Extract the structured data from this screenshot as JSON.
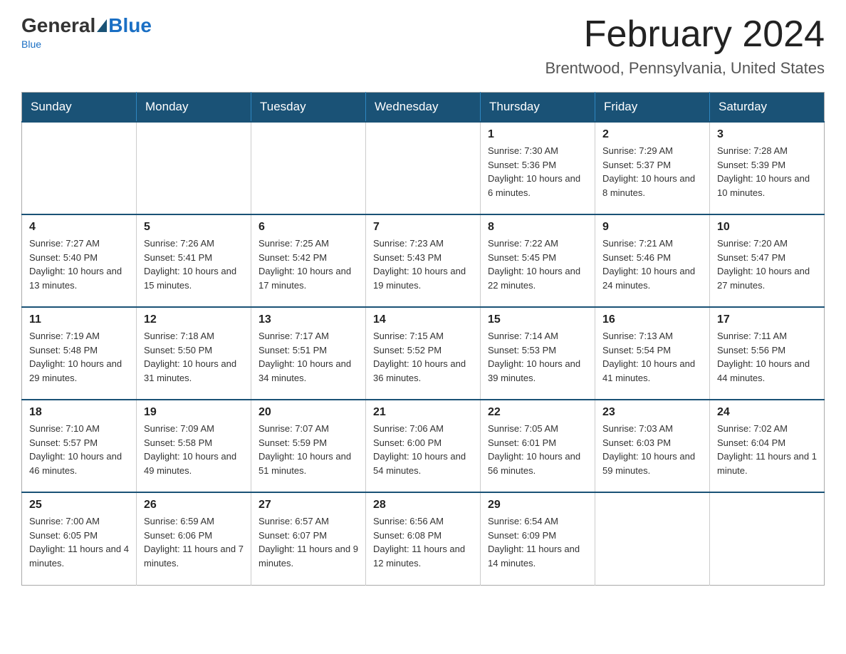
{
  "header": {
    "logo_general": "General",
    "logo_blue": "Blue",
    "title": "February 2024",
    "subtitle": "Brentwood, Pennsylvania, United States"
  },
  "calendar": {
    "days_of_week": [
      "Sunday",
      "Monday",
      "Tuesday",
      "Wednesday",
      "Thursday",
      "Friday",
      "Saturday"
    ],
    "weeks": [
      [
        {
          "day": "",
          "info": ""
        },
        {
          "day": "",
          "info": ""
        },
        {
          "day": "",
          "info": ""
        },
        {
          "day": "",
          "info": ""
        },
        {
          "day": "1",
          "info": "Sunrise: 7:30 AM\nSunset: 5:36 PM\nDaylight: 10 hours and 6 minutes."
        },
        {
          "day": "2",
          "info": "Sunrise: 7:29 AM\nSunset: 5:37 PM\nDaylight: 10 hours and 8 minutes."
        },
        {
          "day": "3",
          "info": "Sunrise: 7:28 AM\nSunset: 5:39 PM\nDaylight: 10 hours and 10 minutes."
        }
      ],
      [
        {
          "day": "4",
          "info": "Sunrise: 7:27 AM\nSunset: 5:40 PM\nDaylight: 10 hours and 13 minutes."
        },
        {
          "day": "5",
          "info": "Sunrise: 7:26 AM\nSunset: 5:41 PM\nDaylight: 10 hours and 15 minutes."
        },
        {
          "day": "6",
          "info": "Sunrise: 7:25 AM\nSunset: 5:42 PM\nDaylight: 10 hours and 17 minutes."
        },
        {
          "day": "7",
          "info": "Sunrise: 7:23 AM\nSunset: 5:43 PM\nDaylight: 10 hours and 19 minutes."
        },
        {
          "day": "8",
          "info": "Sunrise: 7:22 AM\nSunset: 5:45 PM\nDaylight: 10 hours and 22 minutes."
        },
        {
          "day": "9",
          "info": "Sunrise: 7:21 AM\nSunset: 5:46 PM\nDaylight: 10 hours and 24 minutes."
        },
        {
          "day": "10",
          "info": "Sunrise: 7:20 AM\nSunset: 5:47 PM\nDaylight: 10 hours and 27 minutes."
        }
      ],
      [
        {
          "day": "11",
          "info": "Sunrise: 7:19 AM\nSunset: 5:48 PM\nDaylight: 10 hours and 29 minutes."
        },
        {
          "day": "12",
          "info": "Sunrise: 7:18 AM\nSunset: 5:50 PM\nDaylight: 10 hours and 31 minutes."
        },
        {
          "day": "13",
          "info": "Sunrise: 7:17 AM\nSunset: 5:51 PM\nDaylight: 10 hours and 34 minutes."
        },
        {
          "day": "14",
          "info": "Sunrise: 7:15 AM\nSunset: 5:52 PM\nDaylight: 10 hours and 36 minutes."
        },
        {
          "day": "15",
          "info": "Sunrise: 7:14 AM\nSunset: 5:53 PM\nDaylight: 10 hours and 39 minutes."
        },
        {
          "day": "16",
          "info": "Sunrise: 7:13 AM\nSunset: 5:54 PM\nDaylight: 10 hours and 41 minutes."
        },
        {
          "day": "17",
          "info": "Sunrise: 7:11 AM\nSunset: 5:56 PM\nDaylight: 10 hours and 44 minutes."
        }
      ],
      [
        {
          "day": "18",
          "info": "Sunrise: 7:10 AM\nSunset: 5:57 PM\nDaylight: 10 hours and 46 minutes."
        },
        {
          "day": "19",
          "info": "Sunrise: 7:09 AM\nSunset: 5:58 PM\nDaylight: 10 hours and 49 minutes."
        },
        {
          "day": "20",
          "info": "Sunrise: 7:07 AM\nSunset: 5:59 PM\nDaylight: 10 hours and 51 minutes."
        },
        {
          "day": "21",
          "info": "Sunrise: 7:06 AM\nSunset: 6:00 PM\nDaylight: 10 hours and 54 minutes."
        },
        {
          "day": "22",
          "info": "Sunrise: 7:05 AM\nSunset: 6:01 PM\nDaylight: 10 hours and 56 minutes."
        },
        {
          "day": "23",
          "info": "Sunrise: 7:03 AM\nSunset: 6:03 PM\nDaylight: 10 hours and 59 minutes."
        },
        {
          "day": "24",
          "info": "Sunrise: 7:02 AM\nSunset: 6:04 PM\nDaylight: 11 hours and 1 minute."
        }
      ],
      [
        {
          "day": "25",
          "info": "Sunrise: 7:00 AM\nSunset: 6:05 PM\nDaylight: 11 hours and 4 minutes."
        },
        {
          "day": "26",
          "info": "Sunrise: 6:59 AM\nSunset: 6:06 PM\nDaylight: 11 hours and 7 minutes."
        },
        {
          "day": "27",
          "info": "Sunrise: 6:57 AM\nSunset: 6:07 PM\nDaylight: 11 hours and 9 minutes."
        },
        {
          "day": "28",
          "info": "Sunrise: 6:56 AM\nSunset: 6:08 PM\nDaylight: 11 hours and 12 minutes."
        },
        {
          "day": "29",
          "info": "Sunrise: 6:54 AM\nSunset: 6:09 PM\nDaylight: 11 hours and 14 minutes."
        },
        {
          "day": "",
          "info": ""
        },
        {
          "day": "",
          "info": ""
        }
      ]
    ]
  }
}
